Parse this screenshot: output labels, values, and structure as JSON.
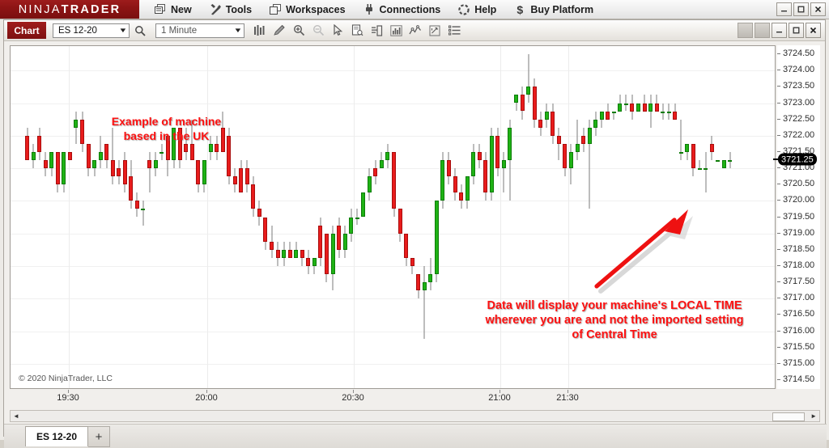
{
  "app": {
    "brand_bold": "NINJATRADER",
    "brand_part1": "NINJA",
    "brand_part2": "TRADER"
  },
  "menubar": {
    "items": [
      {
        "label": "New",
        "icon": "new-window-icon"
      },
      {
        "label": "Tools",
        "icon": "tools-icon"
      },
      {
        "label": "Workspaces",
        "icon": "workspaces-icon"
      },
      {
        "label": "Connections",
        "icon": "plug-icon"
      },
      {
        "label": "Help",
        "icon": "help-icon"
      },
      {
        "label": "Buy Platform",
        "icon": "dollar-icon"
      }
    ],
    "window_buttons": {
      "minimize": "–",
      "maximize": "☐",
      "close": "✕"
    }
  },
  "toolbar": {
    "chart_label": "Chart",
    "instrument": "ES 12-20",
    "timeframe": "1 Minute",
    "search_icon": "search-icon",
    "icons": [
      "bar-chart-type-icon",
      "drawing-tools-icon",
      "zoom-in-icon",
      "zoom-out-icon",
      "cursor-pointer-icon",
      "data-box-icon",
      "chart-template-icon",
      "indicators-icon",
      "strategies-icon",
      "chart-trader-icon",
      "properties-list-icon"
    ],
    "window_buttons": {
      "minimize": "–",
      "maximize": "☐",
      "close": "✕"
    }
  },
  "chart": {
    "copyright": "© 2020 NinjaTrader, LLC",
    "last_price_marker": "3721.25",
    "annotations": [
      {
        "name": "uk-machine-note",
        "text": "Example of machine\nbased in the UK",
        "color": "#fd1111"
      },
      {
        "name": "local-time-note",
        "text": "Data will display your machine's LOCAL TIME wherever you are and not the imported setting of Central Time",
        "color": "#fd1111"
      }
    ],
    "arrow": {
      "name": "callout-arrow",
      "color": "#ee1111"
    }
  },
  "chart_data": {
    "type": "candlestick",
    "title": "ES 12-20 — 1 Minute",
    "xlabel": "",
    "ylabel": "",
    "ylim": [
      3714.25,
      3724.75
    ],
    "grid": true,
    "legend": "none",
    "y_ticks": [
      "3724.50",
      "3724.00",
      "3723.50",
      "3723.00",
      "3722.50",
      "3722.00",
      "3721.50",
      "3721.00",
      "3720.50",
      "3720.00",
      "3719.50",
      "3719.00",
      "3718.50",
      "3718.00",
      "3717.50",
      "3717.00",
      "3716.50",
      "3716.00",
      "3715.50",
      "3715.00",
      "3714.50"
    ],
    "x_ticks": [
      "19:30",
      "20:00",
      "20:30",
      "21:00",
      "21:30"
    ],
    "x_tick_positions": [
      72,
      243,
      424,
      605,
      689
    ],
    "last_price": 3721.25,
    "up_color": "#1fb215",
    "down_color": "#e81c1c",
    "candles": [
      {
        "o": 3722.0,
        "h": 3722.25,
        "l": 3721.25,
        "c": 3721.25
      },
      {
        "o": 3721.25,
        "h": 3721.75,
        "l": 3721.0,
        "c": 3721.5
      },
      {
        "o": 3722.0,
        "h": 3722.25,
        "l": 3721.25,
        "c": 3721.5
      },
      {
        "o": 3721.25,
        "h": 3721.5,
        "l": 3720.75,
        "c": 3721.0
      },
      {
        "o": 3721.0,
        "h": 3721.5,
        "l": 3720.75,
        "c": 3721.5
      },
      {
        "o": 3721.5,
        "h": 3721.5,
        "l": 3720.25,
        "c": 3720.5
      },
      {
        "o": 3720.5,
        "h": 3721.5,
        "l": 3720.25,
        "c": 3721.5
      },
      {
        "o": 3721.5,
        "h": 3721.5,
        "l": 3721.25,
        "c": 3721.25
      },
      {
        "o": 3722.25,
        "h": 3722.75,
        "l": 3721.75,
        "c": 3722.5
      },
      {
        "o": 3722.5,
        "h": 3722.75,
        "l": 3721.5,
        "c": 3721.75
      },
      {
        "o": 3721.75,
        "h": 3721.75,
        "l": 3720.75,
        "c": 3721.0
      },
      {
        "o": 3721.0,
        "h": 3721.25,
        "l": 3720.75,
        "c": 3721.25
      },
      {
        "o": 3721.25,
        "h": 3722.0,
        "l": 3721.0,
        "c": 3721.5
      },
      {
        "o": 3721.75,
        "h": 3721.75,
        "l": 3721.0,
        "c": 3721.25
      },
      {
        "o": 3721.25,
        "h": 3722.25,
        "l": 3720.5,
        "c": 3720.75
      },
      {
        "o": 3721.0,
        "h": 3721.25,
        "l": 3720.5,
        "c": 3720.75
      },
      {
        "o": 3721.25,
        "h": 3721.5,
        "l": 3720.25,
        "c": 3720.5
      },
      {
        "o": 3720.75,
        "h": 3721.25,
        "l": 3719.75,
        "c": 3720.0
      },
      {
        "o": 3720.0,
        "h": 3720.25,
        "l": 3719.5,
        "c": 3719.75
      },
      {
        "o": 3719.75,
        "h": 3720.0,
        "l": 3719.25,
        "c": 3719.75
      },
      {
        "o": 3721.25,
        "h": 3721.5,
        "l": 3720.25,
        "c": 3721.0
      },
      {
        "o": 3721.0,
        "h": 3721.5,
        "l": 3720.75,
        "c": 3721.25
      },
      {
        "o": 3721.5,
        "h": 3721.75,
        "l": 3721.25,
        "c": 3721.5
      },
      {
        "o": 3722.0,
        "h": 3722.0,
        "l": 3720.75,
        "c": 3721.25
      },
      {
        "o": 3721.25,
        "h": 3722.25,
        "l": 3721.0,
        "c": 3722.25
      },
      {
        "o": 3722.25,
        "h": 3722.25,
        "l": 3721.0,
        "c": 3721.25
      },
      {
        "o": 3721.75,
        "h": 3722.25,
        "l": 3721.25,
        "c": 3721.5
      },
      {
        "o": 3721.75,
        "h": 3722.5,
        "l": 3721.25,
        "c": 3721.25
      },
      {
        "o": 3721.25,
        "h": 3721.25,
        "l": 3720.25,
        "c": 3720.5
      },
      {
        "o": 3720.5,
        "h": 3721.25,
        "l": 3720.25,
        "c": 3721.25
      },
      {
        "o": 3721.5,
        "h": 3722.0,
        "l": 3721.25,
        "c": 3721.75
      },
      {
        "o": 3721.75,
        "h": 3722.0,
        "l": 3721.25,
        "c": 3721.5
      },
      {
        "o": 3722.25,
        "h": 3722.75,
        "l": 3721.5,
        "c": 3721.5
      },
      {
        "o": 3722.0,
        "h": 3722.25,
        "l": 3720.5,
        "c": 3720.75
      },
      {
        "o": 3720.75,
        "h": 3721.0,
        "l": 3720.25,
        "c": 3720.5
      },
      {
        "o": 3721.0,
        "h": 3721.25,
        "l": 3720.25,
        "c": 3720.25
      },
      {
        "o": 3721.0,
        "h": 3721.25,
        "l": 3720.25,
        "c": 3720.5
      },
      {
        "o": 3720.5,
        "h": 3720.75,
        "l": 3719.5,
        "c": 3719.75
      },
      {
        "o": 3719.75,
        "h": 3720.0,
        "l": 3719.25,
        "c": 3719.5
      },
      {
        "o": 3719.5,
        "h": 3719.5,
        "l": 3718.5,
        "c": 3718.75
      },
      {
        "o": 3718.75,
        "h": 3719.25,
        "l": 3718.25,
        "c": 3718.5
      },
      {
        "o": 3718.5,
        "h": 3718.75,
        "l": 3718.0,
        "c": 3718.25
      },
      {
        "o": 3718.25,
        "h": 3718.75,
        "l": 3718.0,
        "c": 3718.5
      },
      {
        "o": 3718.5,
        "h": 3718.75,
        "l": 3718.25,
        "c": 3718.25
      },
      {
        "o": 3718.25,
        "h": 3718.75,
        "l": 3718.25,
        "c": 3718.5
      },
      {
        "o": 3718.5,
        "h": 3718.5,
        "l": 3718.0,
        "c": 3718.25
      },
      {
        "o": 3718.25,
        "h": 3718.5,
        "l": 3717.75,
        "c": 3718.0
      },
      {
        "o": 3718.0,
        "h": 3718.25,
        "l": 3717.75,
        "c": 3718.25
      },
      {
        "o": 3719.25,
        "h": 3719.5,
        "l": 3718.0,
        "c": 3718.25
      },
      {
        "o": 3719.0,
        "h": 3719.0,
        "l": 3717.5,
        "c": 3717.75
      },
      {
        "o": 3717.75,
        "h": 3719.25,
        "l": 3717.25,
        "c": 3719.0
      },
      {
        "o": 3719.25,
        "h": 3719.5,
        "l": 3718.25,
        "c": 3718.5
      },
      {
        "o": 3718.5,
        "h": 3719.25,
        "l": 3718.25,
        "c": 3719.0
      },
      {
        "o": 3719.0,
        "h": 3719.75,
        "l": 3718.75,
        "c": 3719.5
      },
      {
        "o": 3719.5,
        "h": 3719.75,
        "l": 3719.25,
        "c": 3719.5
      },
      {
        "o": 3719.5,
        "h": 3720.25,
        "l": 3719.5,
        "c": 3720.25
      },
      {
        "o": 3720.25,
        "h": 3721.0,
        "l": 3720.0,
        "c": 3720.75
      },
      {
        "o": 3721.0,
        "h": 3721.25,
        "l": 3720.5,
        "c": 3720.75
      },
      {
        "o": 3721.0,
        "h": 3721.5,
        "l": 3721.0,
        "c": 3721.25
      },
      {
        "o": 3721.25,
        "h": 3721.75,
        "l": 3721.0,
        "c": 3721.5
      },
      {
        "o": 3721.5,
        "h": 3721.5,
        "l": 3719.5,
        "c": 3719.75
      },
      {
        "o": 3719.75,
        "h": 3719.75,
        "l": 3718.75,
        "c": 3719.0
      },
      {
        "o": 3719.0,
        "h": 3719.0,
        "l": 3718.0,
        "c": 3718.25
      },
      {
        "o": 3718.25,
        "h": 3718.25,
        "l": 3717.75,
        "c": 3718.0
      },
      {
        "o": 3717.75,
        "h": 3717.75,
        "l": 3717.0,
        "c": 3717.25
      },
      {
        "o": 3717.25,
        "h": 3718.0,
        "l": 3715.75,
        "c": 3717.5
      },
      {
        "o": 3717.5,
        "h": 3718.25,
        "l": 3717.25,
        "c": 3717.75
      },
      {
        "o": 3717.75,
        "h": 3720.0,
        "l": 3717.5,
        "c": 3720.0
      },
      {
        "o": 3720.0,
        "h": 3721.5,
        "l": 3719.75,
        "c": 3721.25
      },
      {
        "o": 3721.25,
        "h": 3721.5,
        "l": 3720.5,
        "c": 3720.75
      },
      {
        "o": 3720.75,
        "h": 3721.0,
        "l": 3720.0,
        "c": 3720.25
      },
      {
        "o": 3720.25,
        "h": 3720.5,
        "l": 3719.75,
        "c": 3720.0
      },
      {
        "o": 3720.0,
        "h": 3720.75,
        "l": 3719.75,
        "c": 3720.75
      },
      {
        "o": 3720.75,
        "h": 3721.75,
        "l": 3720.5,
        "c": 3721.5
      },
      {
        "o": 3721.5,
        "h": 3721.75,
        "l": 3721.0,
        "c": 3721.25
      },
      {
        "o": 3721.25,
        "h": 3721.5,
        "l": 3720.0,
        "c": 3720.25
      },
      {
        "o": 3720.25,
        "h": 3722.25,
        "l": 3720.0,
        "c": 3722.0
      },
      {
        "o": 3722.0,
        "h": 3722.25,
        "l": 3720.75,
        "c": 3721.0
      },
      {
        "o": 3721.0,
        "h": 3721.5,
        "l": 3720.25,
        "c": 3721.25
      },
      {
        "o": 3721.25,
        "h": 3722.5,
        "l": 3720.0,
        "c": 3722.25
      },
      {
        "o": 3723.0,
        "h": 3723.25,
        "l": 3722.75,
        "c": 3723.25
      },
      {
        "o": 3723.25,
        "h": 3723.5,
        "l": 3722.5,
        "c": 3722.75
      },
      {
        "o": 3723.25,
        "h": 3724.5,
        "l": 3723.0,
        "c": 3723.5
      },
      {
        "o": 3723.5,
        "h": 3723.75,
        "l": 3722.25,
        "c": 3722.5
      },
      {
        "o": 3722.5,
        "h": 3722.75,
        "l": 3722.0,
        "c": 3722.25
      },
      {
        "o": 3722.5,
        "h": 3723.0,
        "l": 3722.25,
        "c": 3722.75
      },
      {
        "o": 3722.75,
        "h": 3723.0,
        "l": 3721.75,
        "c": 3722.0
      },
      {
        "o": 3722.0,
        "h": 3722.25,
        "l": 3721.25,
        "c": 3721.75
      },
      {
        "o": 3721.75,
        "h": 3721.75,
        "l": 3720.75,
        "c": 3721.0
      },
      {
        "o": 3721.0,
        "h": 3721.75,
        "l": 3720.5,
        "c": 3721.5
      },
      {
        "o": 3721.5,
        "h": 3722.5,
        "l": 3721.25,
        "c": 3721.75
      },
      {
        "o": 3722.0,
        "h": 3722.25,
        "l": 3721.5,
        "c": 3721.75
      },
      {
        "o": 3721.75,
        "h": 3722.5,
        "l": 3719.75,
        "c": 3722.25
      },
      {
        "o": 3722.25,
        "h": 3722.75,
        "l": 3722.0,
        "c": 3722.5
      },
      {
        "o": 3722.5,
        "h": 3722.75,
        "l": 3722.25,
        "c": 3722.75
      },
      {
        "o": 3722.75,
        "h": 3723.0,
        "l": 3722.5,
        "c": 3722.5
      },
      {
        "o": 3722.75,
        "h": 3722.75,
        "l": 3722.5,
        "c": 3722.75
      },
      {
        "o": 3722.75,
        "h": 3723.25,
        "l": 3722.75,
        "c": 3723.0
      },
      {
        "o": 3723.0,
        "h": 3723.25,
        "l": 3722.75,
        "c": 3723.0
      },
      {
        "o": 3723.0,
        "h": 3723.25,
        "l": 3722.5,
        "c": 3722.75
      },
      {
        "o": 3722.75,
        "h": 3723.0,
        "l": 3722.75,
        "c": 3723.0
      },
      {
        "o": 3723.0,
        "h": 3723.25,
        "l": 3722.75,
        "c": 3722.75
      },
      {
        "o": 3722.75,
        "h": 3723.25,
        "l": 3722.25,
        "c": 3723.0
      },
      {
        "o": 3723.0,
        "h": 3723.25,
        "l": 3722.75,
        "c": 3722.75
      },
      {
        "o": 3722.75,
        "h": 3723.0,
        "l": 3722.5,
        "c": 3722.75
      },
      {
        "o": 3722.75,
        "h": 3723.0,
        "l": 3722.5,
        "c": 3722.75
      },
      {
        "o": 3722.75,
        "h": 3723.0,
        "l": 3722.5,
        "c": 3722.5
      },
      {
        "o": 3721.5,
        "h": 3722.5,
        "l": 3721.25,
        "c": 3721.5
      },
      {
        "o": 3721.5,
        "h": 3721.75,
        "l": 3721.25,
        "c": 3721.75
      },
      {
        "o": 3721.75,
        "h": 3721.75,
        "l": 3720.75,
        "c": 3721.0
      },
      {
        "o": 3721.0,
        "h": 3721.25,
        "l": 3721.0,
        "c": 3721.0
      },
      {
        "o": 3721.0,
        "h": 3721.5,
        "l": 3720.25,
        "c": 3721.0
      },
      {
        "o": 3721.75,
        "h": 3722.0,
        "l": 3721.25,
        "c": 3721.5
      },
      {
        "o": 3721.25,
        "h": 3721.25,
        "l": 3721.25,
        "c": 3721.25
      },
      {
        "o": 3721.0,
        "h": 3721.25,
        "l": 3721.0,
        "c": 3721.25
      },
      {
        "o": 3721.25,
        "h": 3721.5,
        "l": 3721.0,
        "c": 3721.25
      }
    ]
  },
  "scrollbar": {
    "left_arrow": "◄",
    "right_arrow": "►"
  },
  "tabs": {
    "items": [
      {
        "label": "ES 12-20"
      }
    ],
    "add_label": "+"
  }
}
